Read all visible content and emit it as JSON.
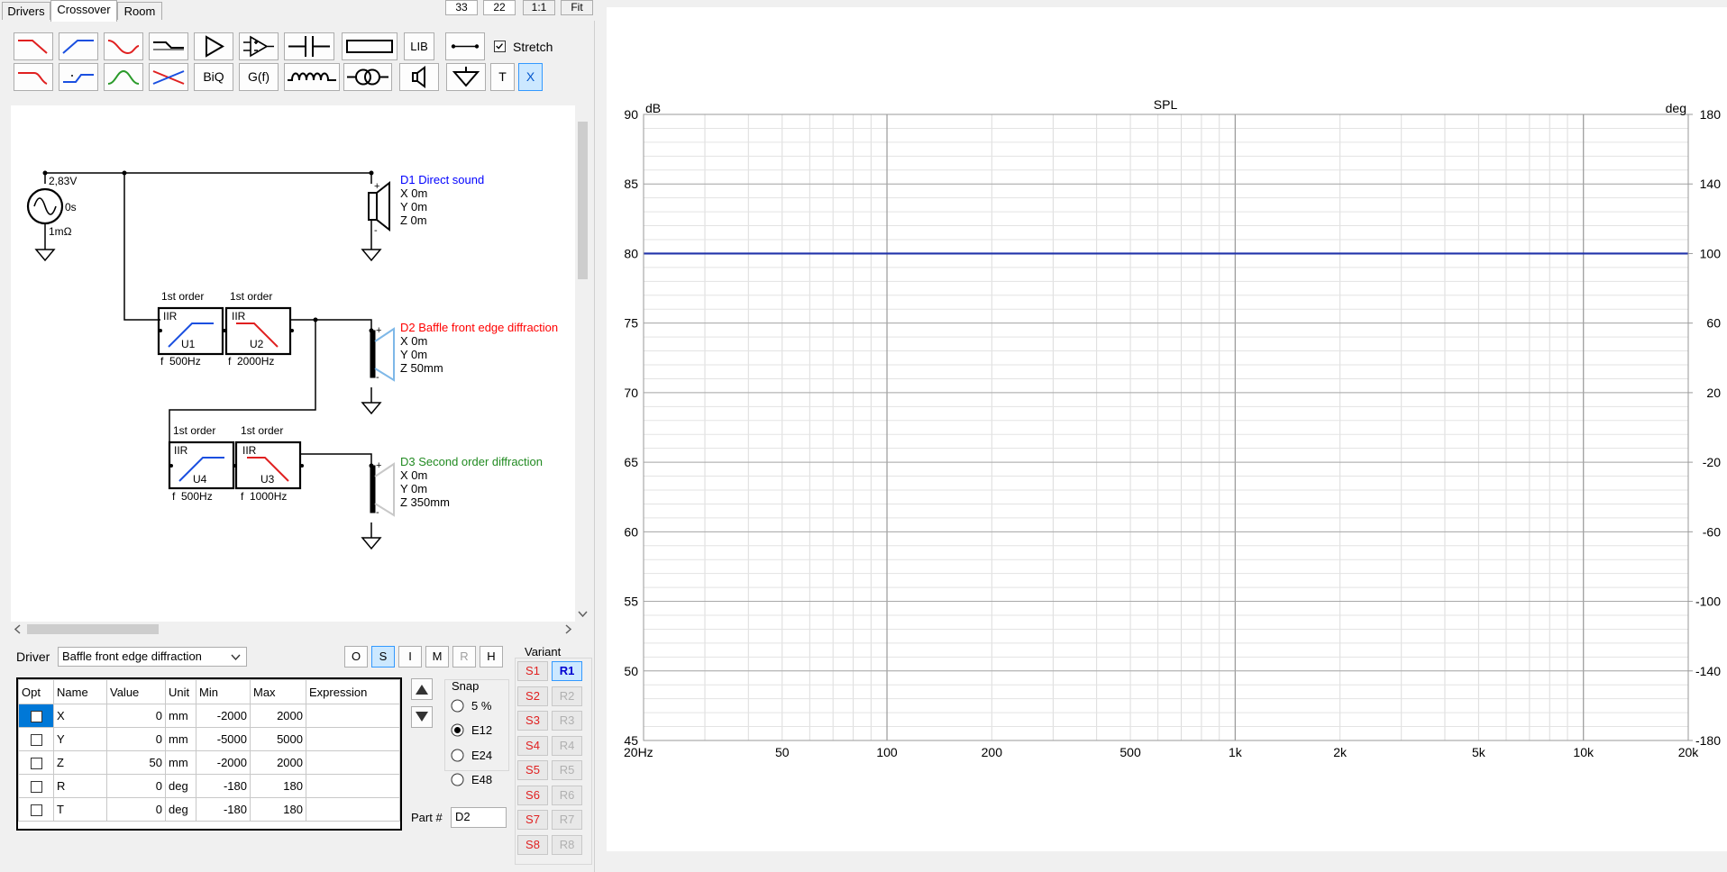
{
  "tabs": [
    "Drivers",
    "Crossover",
    "Room"
  ],
  "top_controls": {
    "box1": "33",
    "box2": "22",
    "one_to_one": "1:1",
    "fit": "Fit"
  },
  "toolbar": {
    "lib": "LIB",
    "biq": "BiQ",
    "gf": "G(f)",
    "stretch": "Stretch",
    "t": "T",
    "x": "X",
    "stretch_checked": true
  },
  "schematic": {
    "source": {
      "voltage": "2,83V",
      "delay": "0s",
      "impedance": "1mΩ"
    },
    "drivers": [
      {
        "label": "D1 Direct sound",
        "x": "X 0m",
        "y": "Y 0m",
        "z": "Z 0m",
        "color": "#0000ff"
      },
      {
        "label": "D2 Baffle front edge diffraction",
        "x": "X 0m",
        "y": "Y 0m",
        "z": "Z 50mm",
        "color": "#ff0000"
      },
      {
        "label": "D3 Second order diffraction",
        "x": "X 0m",
        "y": "Y 0m",
        "z": "Z 350mm",
        "color": "#228b22"
      }
    ],
    "filters": [
      {
        "id": "U1",
        "order": "1st order",
        "type": "IIR",
        "freq": "f  500Hz"
      },
      {
        "id": "U2",
        "order": "1st order",
        "type": "IIR",
        "freq": "f  2000Hz"
      },
      {
        "id": "U4",
        "order": "1st order",
        "type": "IIR",
        "freq": "f  500Hz"
      },
      {
        "id": "U3",
        "order": "1st order",
        "type": "IIR",
        "freq": "f  1000Hz"
      }
    ]
  },
  "driver_select": {
    "label": "Driver",
    "value": "Baffle front edge diffraction"
  },
  "mode_buttons": [
    "O",
    "S",
    "I",
    "M",
    "R",
    "H"
  ],
  "param_table": {
    "headers": [
      "Opt",
      "Name",
      "Value",
      "Unit",
      "Min",
      "Max",
      "Expression"
    ],
    "rows": [
      {
        "name": "X",
        "value": "0",
        "unit": "mm",
        "min": "-2000",
        "max": "2000",
        "expr": ""
      },
      {
        "name": "Y",
        "value": "0",
        "unit": "mm",
        "min": "-5000",
        "max": "5000",
        "expr": ""
      },
      {
        "name": "Z",
        "value": "50",
        "unit": "mm",
        "min": "-2000",
        "max": "2000",
        "expr": ""
      },
      {
        "name": "R",
        "value": "0",
        "unit": "deg",
        "min": "-180",
        "max": "180",
        "expr": ""
      },
      {
        "name": "T",
        "value": "0",
        "unit": "deg",
        "min": "-180",
        "max": "180",
        "expr": ""
      }
    ]
  },
  "snap": {
    "title": "Snap",
    "options": [
      "5 %",
      "E12",
      "E24",
      "E48"
    ],
    "selected": "E12"
  },
  "part": {
    "label": "Part #",
    "value": "D2"
  },
  "variant": {
    "title": "Variant",
    "s": [
      "S1",
      "S2",
      "S3",
      "S4",
      "S5",
      "S6",
      "S7",
      "S8"
    ],
    "r": [
      "R1",
      "R2",
      "R3",
      "R4",
      "R5",
      "R6",
      "R7",
      "R8"
    ],
    "selected_r": "R1"
  },
  "chart_data": {
    "type": "line",
    "title": "SPL",
    "ylabel_left": "dB",
    "ylabel_right": "deg",
    "x_scale": "log",
    "xlim": [
      20,
      20000
    ],
    "ylim_left": [
      45,
      90
    ],
    "ylim_right": [
      -180,
      180
    ],
    "x_ticks": [
      20,
      50,
      100,
      200,
      500,
      1000,
      2000,
      5000,
      10000,
      20000
    ],
    "x_tick_labels": [
      "20Hz",
      "50",
      "100",
      "200",
      "500",
      "1k",
      "2k",
      "5k",
      "10k",
      "20k"
    ],
    "y_ticks_left": [
      45,
      50,
      55,
      60,
      65,
      70,
      75,
      80,
      85,
      90
    ],
    "y_ticks_right": [
      -180,
      -140,
      -100,
      -60,
      -20,
      20,
      60,
      100,
      140,
      180
    ],
    "grid": true,
    "series": [
      {
        "color": "#2233aa",
        "x": [
          20,
          20000
        ],
        "y": [
          80,
          80
        ]
      }
    ]
  }
}
